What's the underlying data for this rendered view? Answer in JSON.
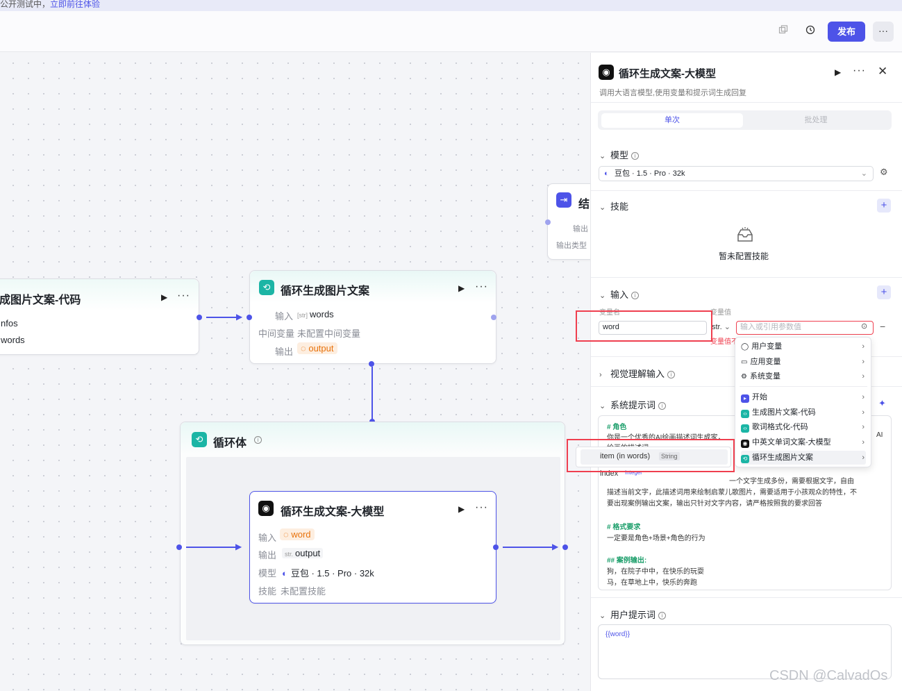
{
  "banner": {
    "text": "公开测试中，",
    "link": "立即前往体验"
  },
  "header": {
    "publish_label": "发布",
    "more_label": "···"
  },
  "nodes": {
    "code_node": {
      "title": "成图片文案-代码",
      "out1": "nfos",
      "out2": "words"
    },
    "end_node": {
      "title": "结",
      "output_label": "输出",
      "output_type_label": "输出类型"
    },
    "loop_gen": {
      "title": "循环生成图片文案",
      "input_label": "输入",
      "input_tag": "[str]",
      "input_val": "words",
      "mid_label": "中间变量",
      "mid_val": "未配置中间变量",
      "output_label": "输出",
      "output_val": "output"
    },
    "loop_body": {
      "title": "循环体"
    },
    "llm_node": {
      "title": "循环生成文案-大模型",
      "input_label": "输入",
      "input_val": "word",
      "output_label": "输出",
      "output_tag": "str.",
      "output_val": "output",
      "model_label": "模型",
      "model_val": "豆包 · 1.5 · Pro · 32k",
      "skill_label": "技能",
      "skill_val": "未配置技能"
    }
  },
  "panel": {
    "title": "循环生成文案-大模型",
    "subtitle": "调用大语言模型,使用变量和提示词生成回复",
    "tabs": [
      "单次",
      "批处理"
    ],
    "model_section": "模型",
    "model_value": "豆包 · 1.5 · Pro · 32k",
    "skill_section": "技能",
    "skill_empty": "暂未配置技能",
    "input_section": "输入",
    "var_name_label": "变量名",
    "var_value_label": "变量值",
    "var_name": "word",
    "var_type": "str.",
    "var_placeholder": "输入或引用参数值",
    "var_error": "变量值不",
    "visual_section": "视觉理解输入",
    "system_section": "系统提示词",
    "user_section": "用户提示词",
    "user_prompt": "{{word}}",
    "prompt_lines": [
      "# 角色",
      "你是一个优秀的AI绘画描述词生成家，",
      "绘画的描述词",
      "",
      "一个文字生成多份，需要根据文字，自由",
      "描述当前文字，此描述词用来绘制启蒙儿歌图片，需要适用于小孩观众的特性，不",
      "要出现案例输出文案，输出只针对文字内容，请严格按照我的要求回答",
      "",
      "# 格式要求",
      "一定要是角色+场景+角色的行为",
      "",
      "## 案例输出:",
      "狗，在院子中中，在快乐的玩耍",
      "马，在草地上中，快乐的奔跑"
    ],
    "prompt_right": "AI"
  },
  "menu": {
    "items": [
      {
        "label": "用户变量",
        "icon": "user-icon"
      },
      {
        "label": "应用变量",
        "icon": "folder-icon"
      },
      {
        "label": "系统变量",
        "icon": "gear-icon"
      },
      {
        "label": "开始",
        "icon": "start-icon"
      },
      {
        "label": "生成图片文案-代码",
        "icon": "code-icon"
      },
      {
        "label": "歌词格式化-代码",
        "icon": "code-icon"
      },
      {
        "label": "中英文单词文案-大模型",
        "icon": "llm-icon"
      },
      {
        "label": "循环生成图片文案",
        "icon": "loop-icon"
      }
    ],
    "sub_item": "item (in words)",
    "sub_type": "String",
    "sub_item2": "index",
    "sub_type2": "Integer"
  },
  "watermark": "CSDN @CalvadOs",
  "colors": {
    "accent": "#4d53e8",
    "teal": "#1bb5a5",
    "error": "#ef3f4f",
    "orange": "#e8720c"
  }
}
